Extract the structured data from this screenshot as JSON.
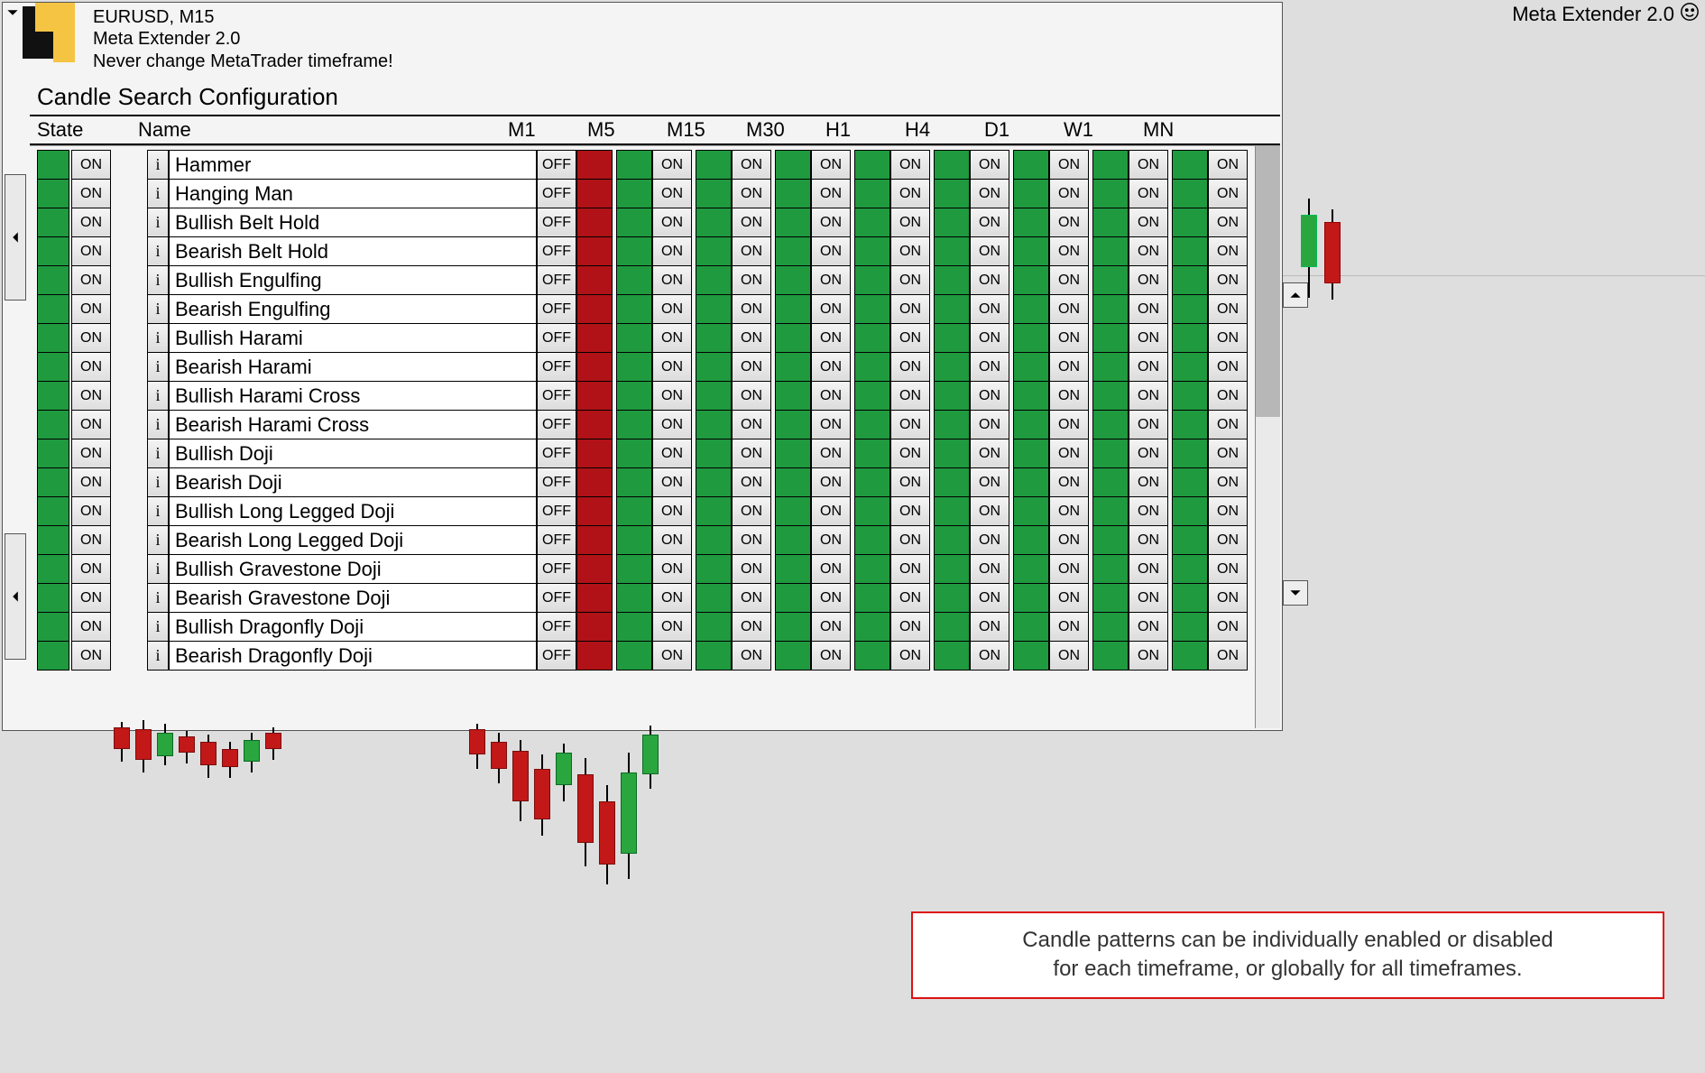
{
  "topright": {
    "label": "Meta Extender 2.0"
  },
  "header": {
    "line1": "EURUSD, M15",
    "line2": "Meta Extender 2.0",
    "line3": "Never change MetaTrader timeframe!"
  },
  "config": {
    "title": "Candle Search Configuration",
    "columns": {
      "state": "State",
      "name": "Name",
      "timeframes": [
        "M1",
        "M5",
        "M15",
        "M30",
        "H1",
        "H4",
        "D1",
        "W1",
        "MN"
      ]
    },
    "on_label": "ON",
    "off_label": "OFF",
    "info_label": "i",
    "patterns": [
      {
        "name": "Hammer",
        "state": "ON",
        "tf": {
          "M1": "OFF",
          "M5": "ON",
          "M15": "ON",
          "M30": "ON",
          "H1": "ON",
          "H4": "ON",
          "D1": "ON",
          "W1": "ON",
          "MN": "ON"
        }
      },
      {
        "name": "Hanging Man",
        "state": "ON",
        "tf": {
          "M1": "OFF",
          "M5": "ON",
          "M15": "ON",
          "M30": "ON",
          "H1": "ON",
          "H4": "ON",
          "D1": "ON",
          "W1": "ON",
          "MN": "ON"
        }
      },
      {
        "name": "Bullish Belt Hold",
        "state": "ON",
        "tf": {
          "M1": "OFF",
          "M5": "ON",
          "M15": "ON",
          "M30": "ON",
          "H1": "ON",
          "H4": "ON",
          "D1": "ON",
          "W1": "ON",
          "MN": "ON"
        }
      },
      {
        "name": "Bearish Belt Hold",
        "state": "ON",
        "tf": {
          "M1": "OFF",
          "M5": "ON",
          "M15": "ON",
          "M30": "ON",
          "H1": "ON",
          "H4": "ON",
          "D1": "ON",
          "W1": "ON",
          "MN": "ON"
        }
      },
      {
        "name": "Bullish Engulfing",
        "state": "ON",
        "tf": {
          "M1": "OFF",
          "M5": "ON",
          "M15": "ON",
          "M30": "ON",
          "H1": "ON",
          "H4": "ON",
          "D1": "ON",
          "W1": "ON",
          "MN": "ON"
        }
      },
      {
        "name": "Bearish Engulfing",
        "state": "ON",
        "tf": {
          "M1": "OFF",
          "M5": "ON",
          "M15": "ON",
          "M30": "ON",
          "H1": "ON",
          "H4": "ON",
          "D1": "ON",
          "W1": "ON",
          "MN": "ON"
        }
      },
      {
        "name": "Bullish Harami",
        "state": "ON",
        "tf": {
          "M1": "OFF",
          "M5": "ON",
          "M15": "ON",
          "M30": "ON",
          "H1": "ON",
          "H4": "ON",
          "D1": "ON",
          "W1": "ON",
          "MN": "ON"
        }
      },
      {
        "name": "Bearish Harami",
        "state": "ON",
        "tf": {
          "M1": "OFF",
          "M5": "ON",
          "M15": "ON",
          "M30": "ON",
          "H1": "ON",
          "H4": "ON",
          "D1": "ON",
          "W1": "ON",
          "MN": "ON"
        }
      },
      {
        "name": "Bullish Harami Cross",
        "state": "ON",
        "tf": {
          "M1": "OFF",
          "M5": "ON",
          "M15": "ON",
          "M30": "ON",
          "H1": "ON",
          "H4": "ON",
          "D1": "ON",
          "W1": "ON",
          "MN": "ON"
        }
      },
      {
        "name": "Bearish Harami Cross",
        "state": "ON",
        "tf": {
          "M1": "OFF",
          "M5": "ON",
          "M15": "ON",
          "M30": "ON",
          "H1": "ON",
          "H4": "ON",
          "D1": "ON",
          "W1": "ON",
          "MN": "ON"
        }
      },
      {
        "name": "Bullish Doji",
        "state": "ON",
        "tf": {
          "M1": "OFF",
          "M5": "ON",
          "M15": "ON",
          "M30": "ON",
          "H1": "ON",
          "H4": "ON",
          "D1": "ON",
          "W1": "ON",
          "MN": "ON"
        }
      },
      {
        "name": "Bearish Doji",
        "state": "ON",
        "tf": {
          "M1": "OFF",
          "M5": "ON",
          "M15": "ON",
          "M30": "ON",
          "H1": "ON",
          "H4": "ON",
          "D1": "ON",
          "W1": "ON",
          "MN": "ON"
        }
      },
      {
        "name": "Bullish Long Legged Doji",
        "state": "ON",
        "tf": {
          "M1": "OFF",
          "M5": "ON",
          "M15": "ON",
          "M30": "ON",
          "H1": "ON",
          "H4": "ON",
          "D1": "ON",
          "W1": "ON",
          "MN": "ON"
        }
      },
      {
        "name": "Bearish Long Legged Doji",
        "state": "ON",
        "tf": {
          "M1": "OFF",
          "M5": "ON",
          "M15": "ON",
          "M30": "ON",
          "H1": "ON",
          "H4": "ON",
          "D1": "ON",
          "W1": "ON",
          "MN": "ON"
        }
      },
      {
        "name": "Bullish Gravestone Doji",
        "state": "ON",
        "tf": {
          "M1": "OFF",
          "M5": "ON",
          "M15": "ON",
          "M30": "ON",
          "H1": "ON",
          "H4": "ON",
          "D1": "ON",
          "W1": "ON",
          "MN": "ON"
        }
      },
      {
        "name": "Bearish Gravestone Doji",
        "state": "ON",
        "tf": {
          "M1": "OFF",
          "M5": "ON",
          "M15": "ON",
          "M30": "ON",
          "H1": "ON",
          "H4": "ON",
          "D1": "ON",
          "W1": "ON",
          "MN": "ON"
        }
      },
      {
        "name": "Bullish Dragonfly Doji",
        "state": "ON",
        "tf": {
          "M1": "OFF",
          "M5": "ON",
          "M15": "ON",
          "M30": "ON",
          "H1": "ON",
          "H4": "ON",
          "D1": "ON",
          "W1": "ON",
          "MN": "ON"
        }
      },
      {
        "name": "Bearish Dragonfly Doji",
        "state": "ON",
        "tf": {
          "M1": "OFF",
          "M5": "ON",
          "M15": "ON",
          "M30": "ON",
          "H1": "ON",
          "H4": "ON",
          "D1": "ON",
          "W1": "ON",
          "MN": "ON"
        }
      }
    ]
  },
  "callout": {
    "line1": "Candle patterns can be individually enabled or disabled",
    "line2": "for each timeframe, or globally for all timeframes."
  },
  "colors": {
    "on": "#1f9a3f",
    "off": "#b01217",
    "panel_border": "#555555",
    "callout_border": "#dd1111"
  }
}
